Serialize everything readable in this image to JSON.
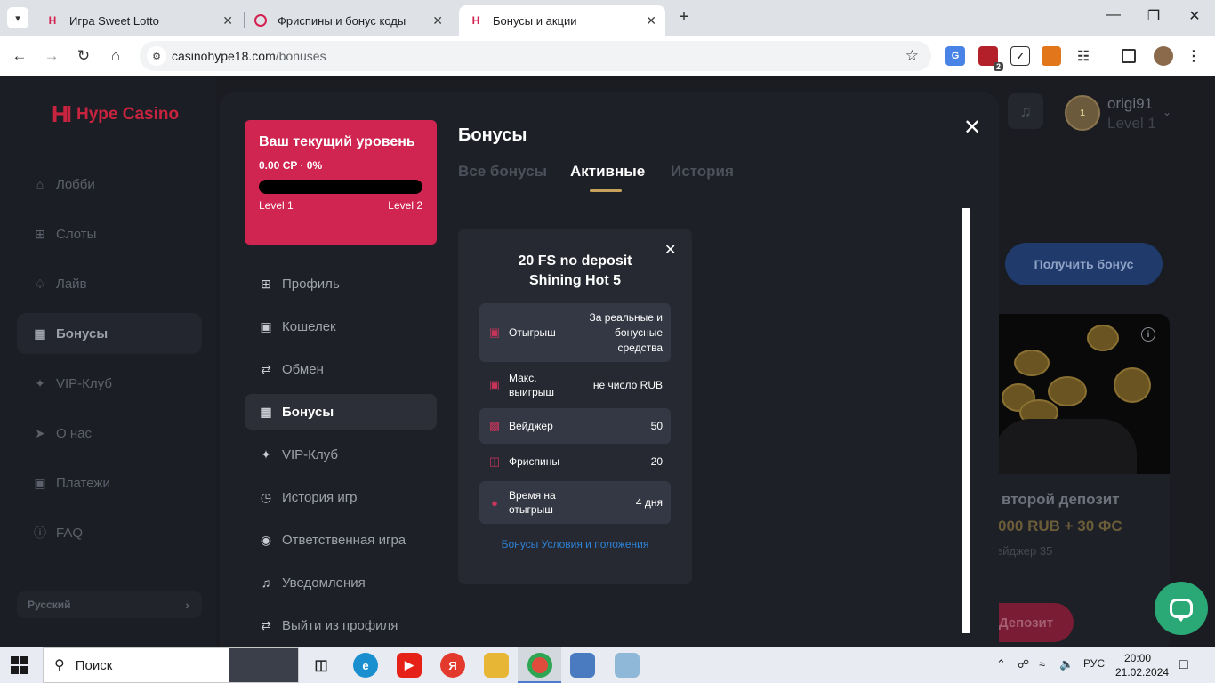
{
  "browser": {
    "tabs": [
      {
        "title": "Игра Sweet Lotto"
      },
      {
        "title": "Фриспины и бонус коды"
      },
      {
        "title": "Бонусы и акции"
      }
    ],
    "url_host": "casinohype18.com",
    "url_path": "/bonuses",
    "ext_badge": "2"
  },
  "site": {
    "logo": "Hype Casino",
    "sidebar": [
      {
        "label": "Лобби",
        "icon": "home-icon"
      },
      {
        "label": "Слоты",
        "icon": "grid-icon"
      },
      {
        "label": "Лайв",
        "icon": "spade-icon"
      },
      {
        "label": "Бонусы",
        "icon": "ticket-icon"
      },
      {
        "label": "VIP-Клуб",
        "icon": "sparkle-icon"
      },
      {
        "label": "О нас",
        "icon": "rocket-icon"
      },
      {
        "label": "Платежи",
        "icon": "wallet-icon"
      },
      {
        "label": "FAQ",
        "icon": "info-icon"
      }
    ],
    "language": "Русский",
    "user": {
      "name": "origi91",
      "level": "Level 1",
      "avatar_level": "1"
    },
    "get_bonus": "Получить бонус",
    "promo": {
      "title": "второй депозит",
      "amount": "000 RUB + 30 ФС",
      "wager": "ейджер 35",
      "deposit": "Депозит"
    }
  },
  "modal": {
    "level_card": {
      "title": "Ваш текущий уровень",
      "progress_text": "0.00 CP · 0%",
      "progress": 0,
      "from": "Level 1",
      "to": "Level 2"
    },
    "menu": [
      {
        "label": "Профиль",
        "icon": "grid-icon"
      },
      {
        "label": "Кошелек",
        "icon": "wallet-icon"
      },
      {
        "label": "Обмен",
        "icon": "exchange-icon"
      },
      {
        "label": "Бонусы",
        "icon": "ticket-icon"
      },
      {
        "label": "VIP-Клуб",
        "icon": "sparkle-icon"
      },
      {
        "label": "История игр",
        "icon": "clock-icon"
      },
      {
        "label": "Ответственная игра",
        "icon": "eye-icon"
      },
      {
        "label": "Уведомления",
        "icon": "bell-icon"
      },
      {
        "label": "Выйти из профиля",
        "icon": "exchange-icon"
      }
    ],
    "title": "Бонусы",
    "tabs": [
      {
        "label": "Все бонусы"
      },
      {
        "label": "Активные"
      },
      {
        "label": "История"
      }
    ],
    "bonus_card": {
      "title_line1": "20 FS no deposit",
      "title_line2": "Shining Hot 5",
      "rows": [
        {
          "label": "Отыгрыш",
          "value": "За реальные и бонусные средства",
          "icon": "wallet-icon"
        },
        {
          "label": "Макс. выигрыш",
          "value": "не число RUB",
          "icon": "wallet-icon"
        },
        {
          "label": "Вейджер",
          "value": "50",
          "icon": "cash-icon"
        },
        {
          "label": "Фриспины",
          "value": "20",
          "icon": "freespin-icon"
        },
        {
          "label": "Время на отыгрыш",
          "value": "4 дня",
          "icon": "clock-icon"
        }
      ],
      "terms_link": "Бонусы Условия и положения"
    }
  },
  "taskbar": {
    "search": "Поиск",
    "lang": "РУС",
    "time": "20:00",
    "date": "21.02.2024"
  }
}
